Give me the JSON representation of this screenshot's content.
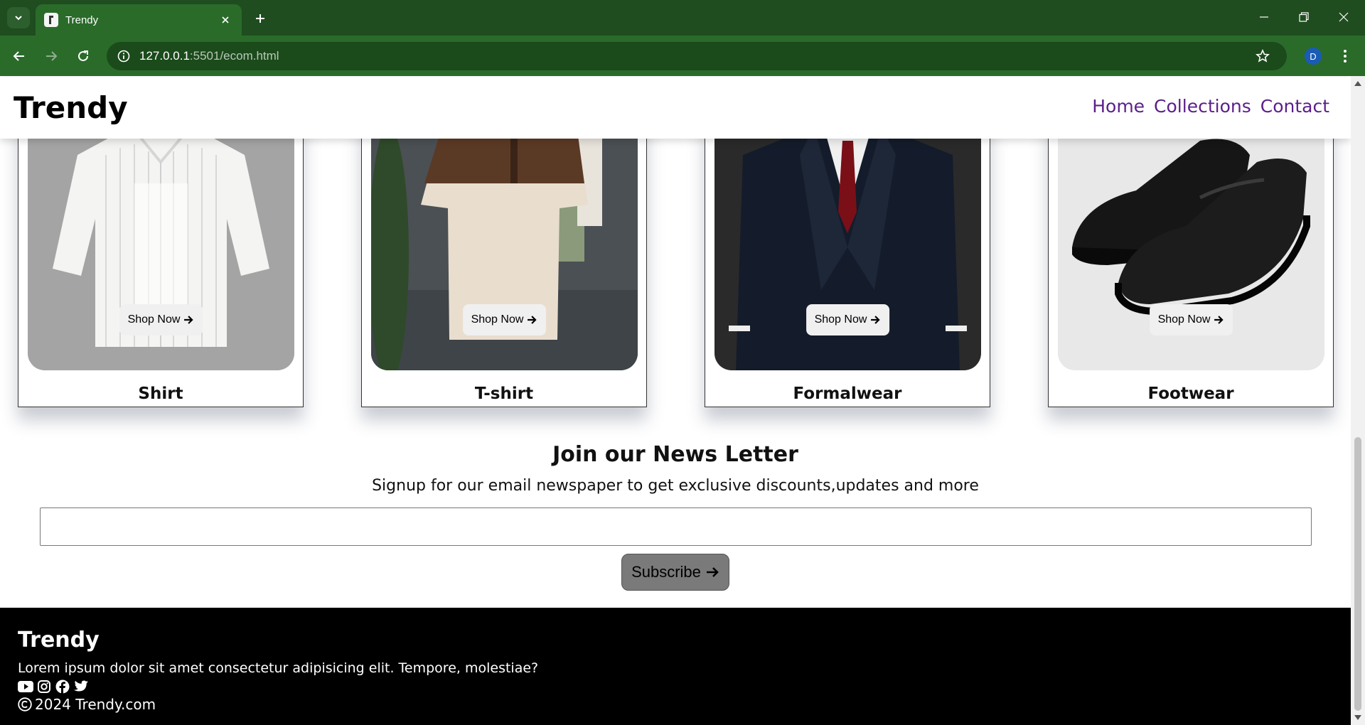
{
  "browser": {
    "tab_title": "Trendy",
    "url_host": "127.0.0.1",
    "url_rest": ":5501/ecom.html",
    "profile_initial": "D"
  },
  "header": {
    "brand": "Trendy",
    "nav": [
      "Home",
      "Collections",
      "Contact"
    ]
  },
  "categories": [
    {
      "title": "Shirt",
      "button": "Shop Now"
    },
    {
      "title": "T-shirt",
      "button": "Shop Now"
    },
    {
      "title": "Formalwear",
      "button": "Shop Now"
    },
    {
      "title": "Footwear",
      "button": "Shop Now"
    }
  ],
  "newsletter": {
    "title": "Join our News Letter",
    "subtitle": "Signup for our email newspaper to get exclusive discounts,updates and more",
    "input_value": "",
    "button": "Subscribe"
  },
  "footer": {
    "brand": "Trendy",
    "text": "Lorem ipsum dolor sit amet consectetur adipisicing elit. Tempore, molestiae?",
    "social_icons": [
      "youtube-icon",
      "instagram-icon",
      "facebook-icon",
      "twitter-icon"
    ],
    "copyright": "2024 Trendy.com"
  },
  "colors": {
    "chrome_dark": "#1f4d1f",
    "chrome_toolbar": "#2a6b2a",
    "nav_link": "#5b1f8a",
    "footer_bg": "#000000",
    "subscribe_bg": "#7a7a7a"
  }
}
